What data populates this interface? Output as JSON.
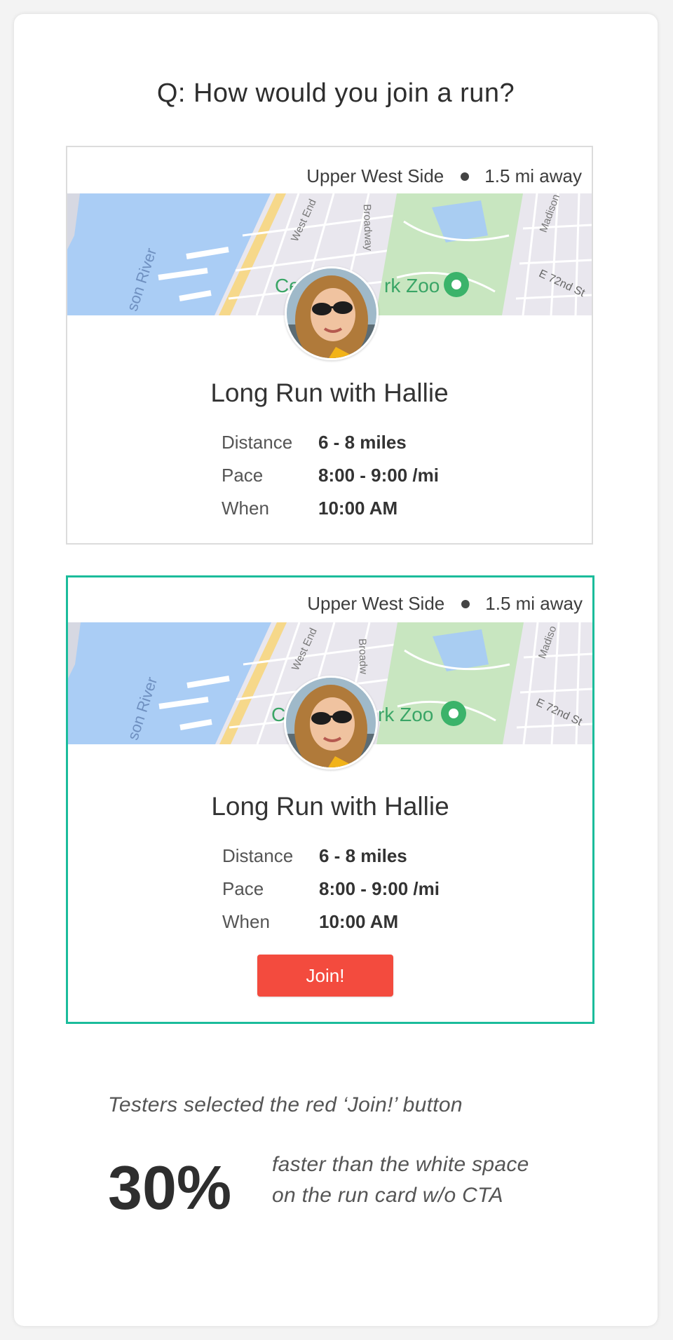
{
  "question": "Q: How would you join a run?",
  "cards": [
    {
      "location": "Upper West Side",
      "distance_away": "1.5 mi away",
      "map_labels": [
        "son River",
        "West End",
        "Broadway",
        "Madison",
        "Ce",
        "rk Zoo",
        "E 72nd St"
      ],
      "title": "Long Run with Hallie",
      "details": [
        {
          "label": "Distance",
          "value": "6 - 8 miles"
        },
        {
          "label": "Pace",
          "value": "8:00 - 9:00 /mi"
        },
        {
          "label": "When",
          "value": "10:00 AM"
        }
      ]
    },
    {
      "location": "Upper West Side",
      "distance_away": "1.5 mi away",
      "map_labels": [
        "son River",
        "West End",
        "Broadw",
        "Madiso",
        "C",
        "rk Zoo",
        "E 72nd St"
      ],
      "title": "Long Run with Hallie",
      "details": [
        {
          "label": "Distance",
          "value": "6 - 8 miles"
        },
        {
          "label": "Pace",
          "value": "8:00 - 9:00 /mi"
        },
        {
          "label": "When",
          "value": "10:00 AM"
        }
      ],
      "cta": "Join!"
    }
  ],
  "insight": "Testers selected the red ‘Join!’ button",
  "stat": "30%",
  "stat_description": [
    "faster than the white space",
    "on the run card w/o CTA"
  ],
  "colors": {
    "accent_border": "#1bbc9b",
    "cta": "#f34b3e",
    "map_water": "#aacdf5",
    "map_park": "#c8e6c0"
  }
}
